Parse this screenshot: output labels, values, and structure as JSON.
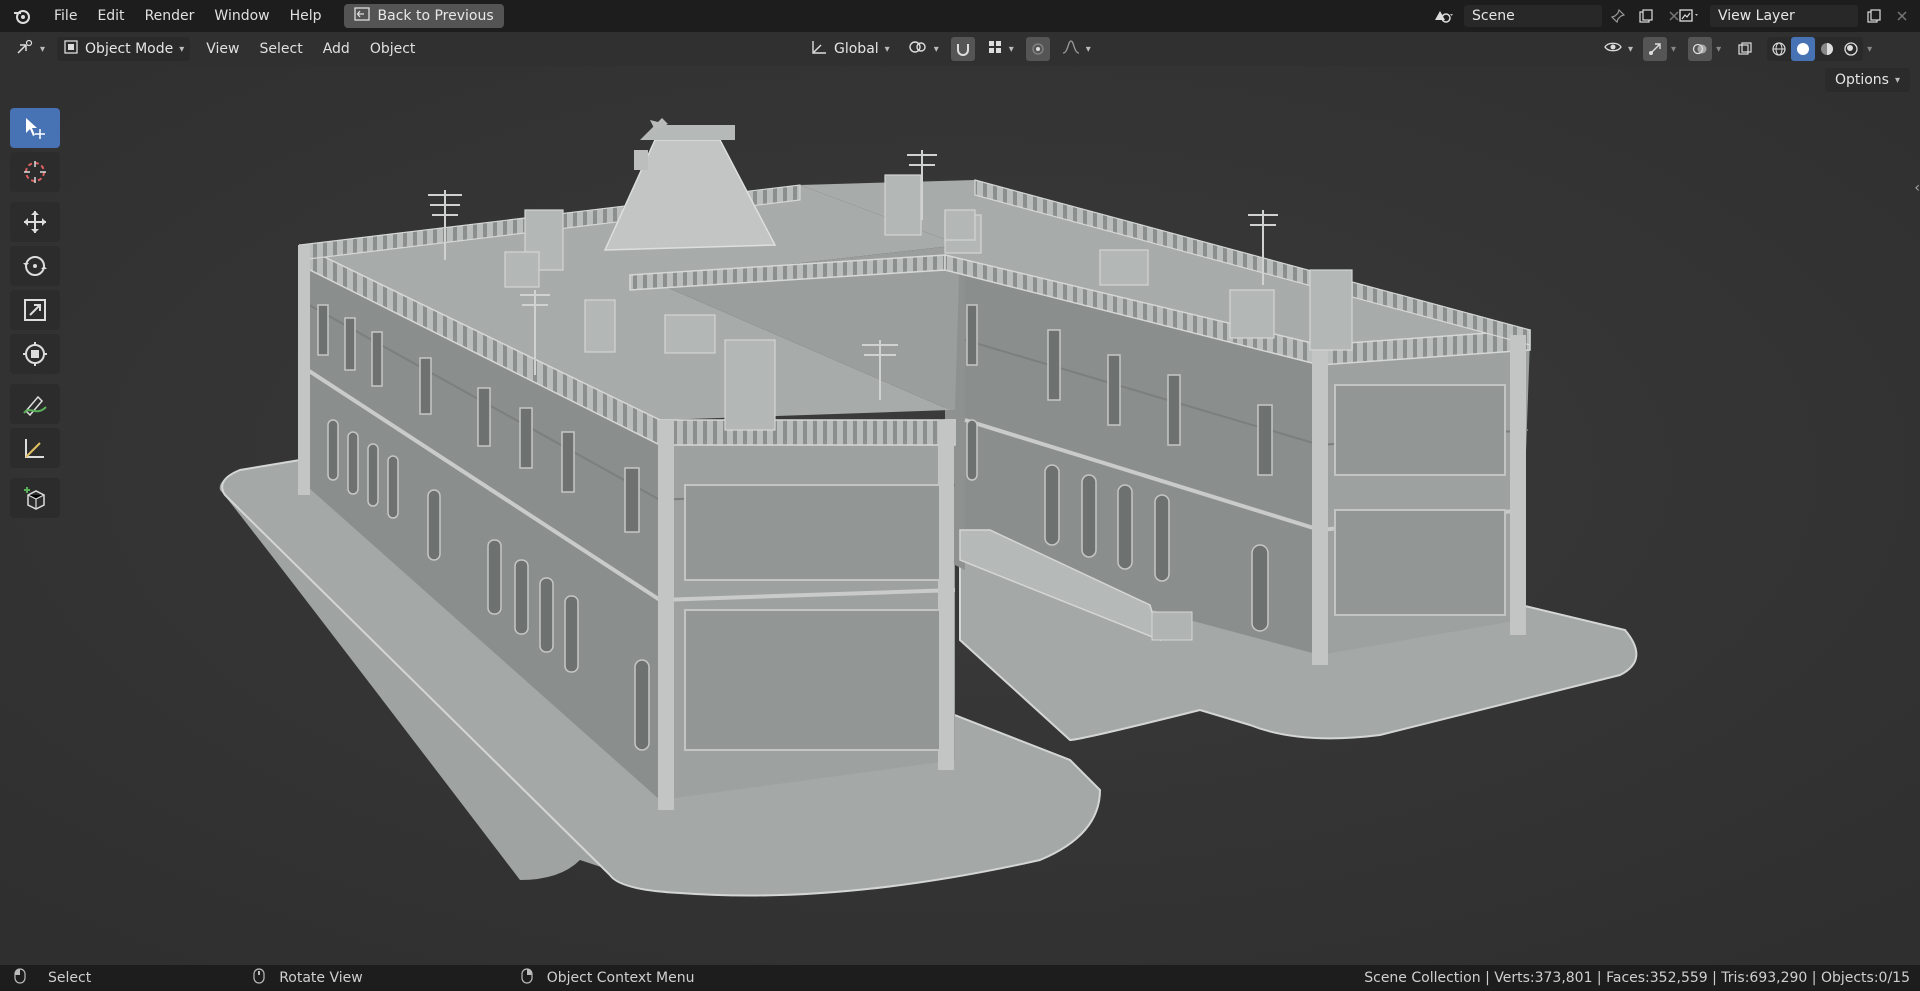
{
  "menu": {
    "items": [
      "File",
      "Edit",
      "Render",
      "Window",
      "Help"
    ],
    "back_label": "Back to Previous"
  },
  "scene": {
    "name": "Scene",
    "view_layer": "View Layer"
  },
  "header": {
    "mode": "Object Mode",
    "menus": [
      "View",
      "Select",
      "Add",
      "Object"
    ],
    "transform_orientation": "Global",
    "options_label": "Options"
  },
  "status": {
    "hint_select": "Select",
    "hint_rotate": "Rotate View",
    "hint_context": "Object Context Menu",
    "stats": "Scene Collection | Verts:373,801 | Faces:352,559 | Tris:693,290 | Objects:0/15"
  },
  "icons": [
    "blender-logo-icon",
    "back-icon",
    "editor-type-icon",
    "object-mode-icon",
    "global-orientation-icon",
    "pivot-icon",
    "snap-icon",
    "snap-grid-icon",
    "proportional-icon",
    "falloff-icon",
    "visibility-icon",
    "gizmo-icon",
    "overlay-icon",
    "xray-icon",
    "wireframe-shading-icon",
    "solid-shading-icon",
    "material-shading-icon",
    "rendered-shading-icon",
    "scene-icon",
    "pin-icon",
    "copy-icon",
    "close-icon",
    "view-layer-icon",
    "select-box-tool-icon",
    "cursor-tool-icon",
    "move-tool-icon",
    "rotate-tool-icon",
    "scale-tool-icon",
    "transform-tool-icon",
    "annotate-tool-icon",
    "measure-tool-icon",
    "add-cube-tool-icon",
    "mouse-left-icon",
    "mouse-middle-icon",
    "mouse-right-icon"
  ],
  "colors": {
    "accent": "#4772b3",
    "viewport": "#3a3a3a",
    "model": "#a7aba9"
  }
}
